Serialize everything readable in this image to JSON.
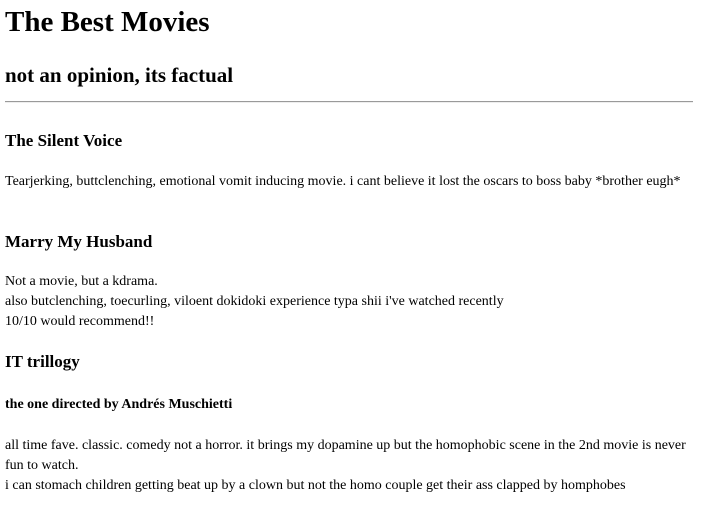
{
  "header": {
    "title": "The Best Movies",
    "subtitle": "not an opinion, its factual"
  },
  "movies": [
    {
      "title": "The Silent Voice",
      "lines": [
        "Tearjerking, buttclenching, emotional vomit inducing movie. i cant believe it lost the oscars to boss baby *brother eugh*"
      ]
    },
    {
      "title": "Marry My Husband",
      "lines": [
        "Not a movie, but a kdrama.",
        "also butclenching, toecurling, viloent dokidoki experience typa shii i've watched recently",
        "10/10 would recommend!!"
      ]
    },
    {
      "title": "IT trillogy",
      "subheading": "the one directed by Andrés Muschietti",
      "lines": [
        "all time fave. classic. comedy not a horror. it brings my dopamine up but the homophobic scene in the 2nd movie is never fun to watch.",
        "i can stomach children getting beat up by a clown but not the homo couple get their ass clapped by homphobes"
      ]
    }
  ]
}
